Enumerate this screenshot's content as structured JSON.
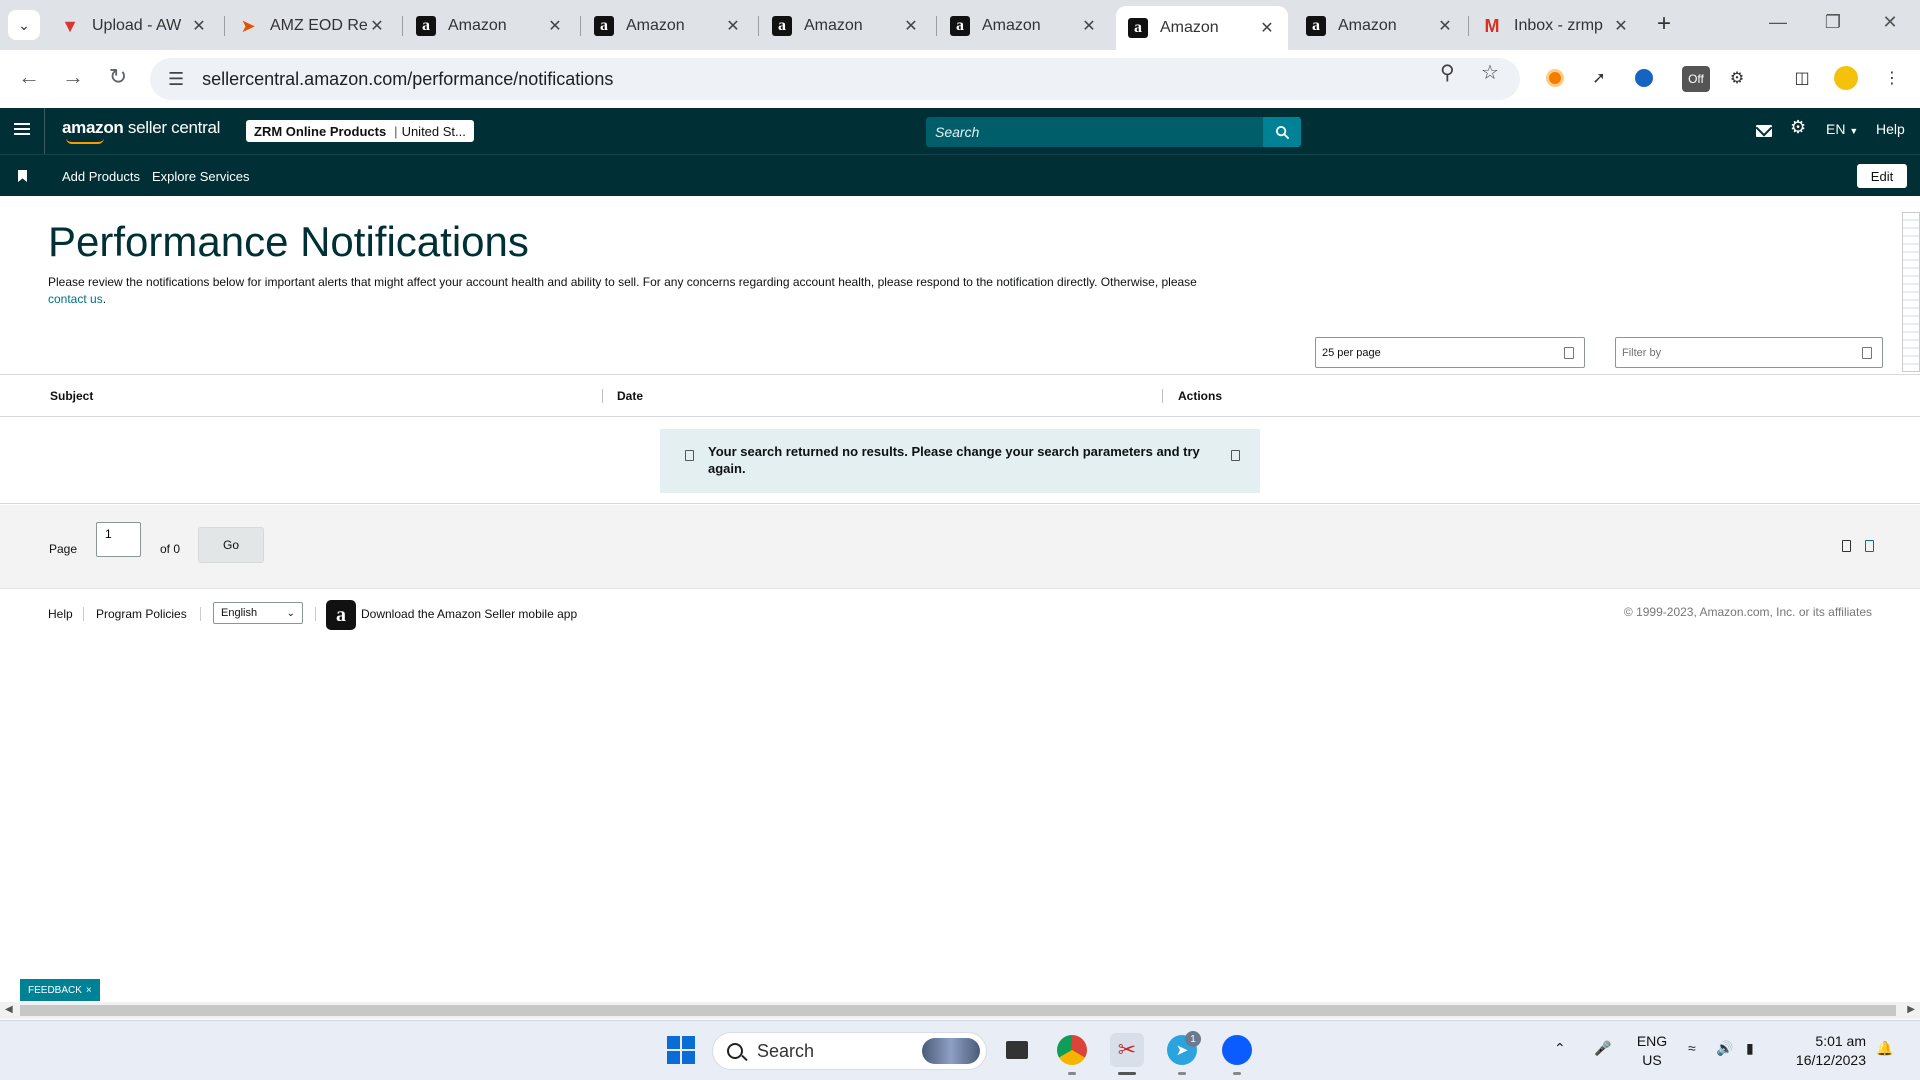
{
  "browser": {
    "tabs": [
      {
        "title": "Upload - AW",
        "favicon": "aws-icon",
        "active": false
      },
      {
        "title": "AMZ EOD Re",
        "favicon": "eod-icon",
        "active": false
      },
      {
        "title": "Amazon",
        "favicon": "amazon-icon",
        "active": false
      },
      {
        "title": "Amazon",
        "favicon": "amazon-icon",
        "active": false
      },
      {
        "title": "Amazon",
        "favicon": "amazon-icon",
        "active": false
      },
      {
        "title": "Amazon",
        "favicon": "amazon-icon",
        "active": false
      },
      {
        "title": "Amazon",
        "favicon": "amazon-icon",
        "active": true
      },
      {
        "title": "Amazon",
        "favicon": "amazon-icon",
        "active": false
      },
      {
        "title": "Inbox - zrmp",
        "favicon": "gmail-icon",
        "active": false
      }
    ],
    "url": "sellercentral.amazon.com/performance/notifications",
    "new_tab": "+",
    "ext_badge": "Off"
  },
  "header": {
    "logo_bold": "amazon",
    "logo_light": " seller central",
    "account_name": "ZRM Online Products",
    "account_region": "United St...",
    "search_placeholder": "Search",
    "language": "EN",
    "help": "Help"
  },
  "bookmarks": {
    "links": [
      "Add Products",
      "Explore Services"
    ],
    "edit": "Edit"
  },
  "page": {
    "title": "Performance Notifications",
    "intro": "Please review the notifications below for important alerts that might affect your account health and ability to sell. For any concerns regarding account health, please respond to the notification directly. Otherwise, please",
    "contact_link": "contact us",
    "per_page": "25 per page",
    "filter_placeholder": "Filter by",
    "columns": [
      "Subject",
      "Date",
      "Actions"
    ],
    "no_results": "Your search returned no results. Please change your search parameters and try again.",
    "pager": {
      "page_label": "Page",
      "page_value": "1",
      "of_label": "of 0",
      "go": "Go"
    }
  },
  "footer": {
    "help": "Help",
    "policies": "Program Policies",
    "language": "English",
    "app_link": "Download the Amazon Seller mobile app",
    "copyright": "© 1999-2023, Amazon.com, Inc. or its affiliates"
  },
  "feedback": {
    "label": "FEEDBACK",
    "close": "×"
  },
  "taskbar": {
    "search": "Search",
    "lang_top": "ENG",
    "lang_bottom": "US",
    "time": "5:01 am",
    "date": "16/12/2023",
    "telegram_badge": "1"
  },
  "colors": {
    "header_bg": "#002f36",
    "search_btn": "#008296",
    "link": "#007185",
    "title": "#002f36"
  }
}
